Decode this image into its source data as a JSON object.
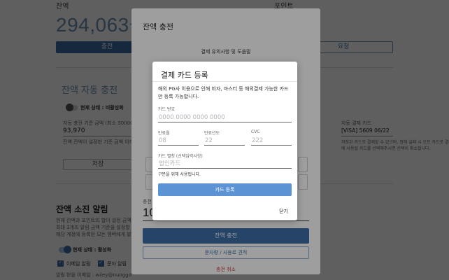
{
  "background": {
    "balance_label": "잔액",
    "balance_value": "294,063원",
    "points_label": "포인트",
    "charge_button": "충전",
    "request_button": "요청",
    "auto_charge_title": "잔액 자동 충전",
    "auto_status": "현재 상태 : 비활성화",
    "auto_threshold_label": "자동 충전 기준 금액 (최소 30000)",
    "auto_threshold_value": "93,970",
    "auto_desc": "잔액 잔액이 설정한 기준 금액 이하인 경",
    "save_button": "저장",
    "card_label": "자동 결제 카드",
    "card_value": "[VISA] 5609 06/22",
    "card_desc": "저장된 카드로 결제할 수 있으며, 정해 실패 시 오프 카드로 결제",
    "card_desc2": "에 사용될 카드를 선택해주시면 선택이 취소됩니다.",
    "alert_title": "잔액 소진 알림",
    "alert_desc1": "현재 잔액과 포인트의 합이 설정 금액",
    "alert_desc2": "최대 3개의 알림 금액 기준을 설정할",
    "alert_desc3": "해당 계정에 등록된 모든 멤버에게 발",
    "alert_status": "현재 상태 : 활성화",
    "email_alert": "이메일 알림",
    "sms_alert": "문자 알림",
    "email_target": "알림 받을 이메일 : wiley@nunggo"
  },
  "charge_dialog": {
    "title": "잔액 충전",
    "notice": "결제 유의사항 및 도움말",
    "amount_label": "충전",
    "amount_value": "10",
    "charge_button": "잔액 충전",
    "quote_button": "문자량 / 사용료 견적",
    "cancel_button": "충전 취소"
  },
  "card_dialog": {
    "title": "결제 카드 등록",
    "description": "해외 PG사 이용으로 인해 비자, 마스터 등 해외결제 가능한 카드만 등록 가능합니다.",
    "card_number_label": "카드 번호",
    "card_number_placeholder": "0000 0000 0000 0000",
    "expiry_month_label": "만료월",
    "expiry_month_placeholder": "08",
    "expiry_year_label": "만료년도",
    "expiry_year_placeholder": "22",
    "cvc_label": "CVC",
    "cvc_placeholder": "222",
    "alias_label": "카드 별칭 (선택입력사항)",
    "alias_placeholder": "법인카드",
    "alias_hint": "구분을 위해 사용됩니다.",
    "submit_button": "카드 등록",
    "close_button": "닫기"
  },
  "colors": {
    "primary": "#3c6fa8",
    "submit": "#5b93d5",
    "danger": "#d33b3b",
    "success": "#2eaa5c"
  }
}
